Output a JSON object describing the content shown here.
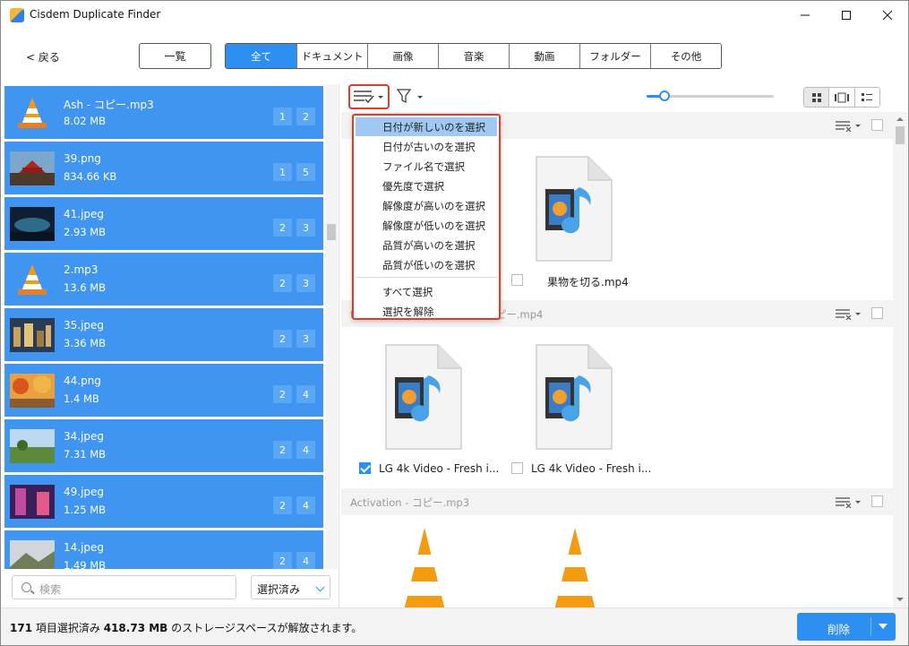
{
  "window": {
    "title": "Cisdem Duplicate Finder",
    "minimize_icon": "minimize-icon",
    "maximize_icon": "maximize-icon",
    "close_icon": "close-icon"
  },
  "nav": {
    "back_label": "< 戻る",
    "list_label": "一覧",
    "tabs": [
      {
        "label": "全て",
        "active": true
      },
      {
        "label": "ドキュメント",
        "active": false
      },
      {
        "label": "画像",
        "active": false
      },
      {
        "label": "音楽",
        "active": false
      },
      {
        "label": "動画",
        "active": false
      },
      {
        "label": "フォルダー",
        "active": false
      },
      {
        "label": "その他",
        "active": false
      }
    ]
  },
  "left_list": {
    "items": [
      {
        "name": "Ash - コピー.mp3",
        "size": "8.02 MB",
        "badge_a": "1",
        "badge_b": "2",
        "thumb": "vlc-cone"
      },
      {
        "name": "39.png",
        "size": "834.66 KB",
        "badge_a": "1",
        "badge_b": "5",
        "thumb": "photo-temple"
      },
      {
        "name": "41.jpeg",
        "size": "2.93 MB",
        "badge_a": "2",
        "badge_b": "3",
        "thumb": "photo-night"
      },
      {
        "name": "2.mp3",
        "size": "13.6 MB",
        "badge_a": "2",
        "badge_b": "3",
        "thumb": "vlc-cone"
      },
      {
        "name": "35.jpeg",
        "size": "3.36 MB",
        "badge_a": "2",
        "badge_b": "3",
        "thumb": "photo-city"
      },
      {
        "name": "44.png",
        "size": "1.4 MB",
        "badge_a": "2",
        "badge_b": "4",
        "thumb": "photo-autumn"
      },
      {
        "name": "34.jpeg",
        "size": "7.31 MB",
        "badge_a": "2",
        "badge_b": "4",
        "thumb": "photo-field"
      },
      {
        "name": "49.jpeg",
        "size": "1.25 MB",
        "badge_a": "2",
        "badge_b": "4",
        "thumb": "photo-purple"
      },
      {
        "name": "14.jpeg",
        "size": "1.49 MB",
        "badge_a": "2",
        "badge_b": "4",
        "thumb": "photo-landscape"
      }
    ],
    "search_placeholder": "検索",
    "filter_select": "選択済み"
  },
  "sort_menu": {
    "items": [
      "日付が新しいのを選択",
      "日付が古いのを選択",
      "ファイル名で選択",
      "優先度で選択",
      "解像度が高いのを選択",
      "解像度が低いのを選択",
      "品質が高いのを選択",
      "品質が低いのを選択",
      "すべて選択",
      "選択を解除"
    ],
    "highlighted_index": 0
  },
  "groups": [
    {
      "title": "",
      "files": [
        {
          "name": "果物を切る.mp4",
          "checked": false,
          "icon": "video-file-icon"
        }
      ]
    },
    {
      "title": "tal Ultra HD 60 FPS.f137 - コピー.mp4",
      "files": [
        {
          "name": "LG 4k Video - Fresh i...",
          "checked": true,
          "icon": "video-file-icon"
        },
        {
          "name": "LG 4k Video - Fresh i...",
          "checked": false,
          "icon": "video-file-icon"
        }
      ]
    },
    {
      "title": "Activation - コピー.mp3",
      "files": [
        {
          "name": "",
          "checked": false,
          "icon": "vlc-cone"
        },
        {
          "name": "",
          "checked": false,
          "icon": "vlc-cone"
        }
      ]
    }
  ],
  "status": {
    "count": "171",
    "count_label": "項目選択済み",
    "size": "418.73 MB",
    "size_label": "のストレージスペースが解放されます。",
    "delete_label": "削除"
  },
  "colors": {
    "accent": "#2d8ff0",
    "list_item_bg": "#3f95f0",
    "highlight_border": "#e23a2b"
  }
}
